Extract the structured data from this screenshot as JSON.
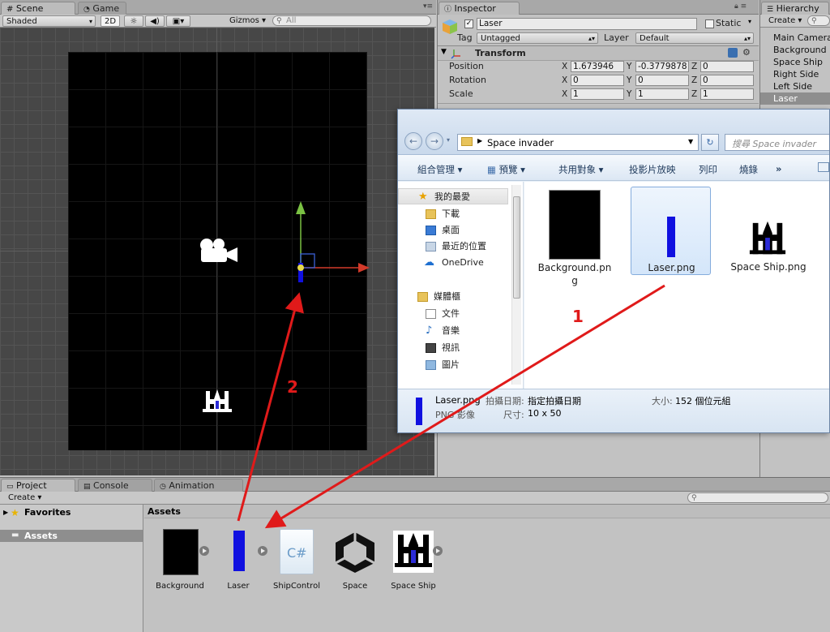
{
  "scene": {
    "tab_label": "Scene",
    "game_tab_label": "Game",
    "shading_mode": "Shaded",
    "mode_2d": "2D",
    "gizmos_label": "Gizmos",
    "search_placeholder": "All"
  },
  "inspector": {
    "tab_label": "Inspector",
    "object_name": "Laser",
    "static_label": "Static",
    "tag_label": "Tag",
    "tag_value": "Untagged",
    "layer_label": "Layer",
    "layer_value": "Default",
    "transform": {
      "title": "Transform",
      "rows": [
        {
          "label": "Position",
          "x": "1.673946",
          "y": "-0.3779878",
          "z": "0"
        },
        {
          "label": "Rotation",
          "x": "0",
          "y": "0",
          "z": "0"
        },
        {
          "label": "Scale",
          "x": "1",
          "y": "1",
          "z": "1"
        }
      ],
      "axis_x": "X",
      "axis_y": "Y",
      "axis_z": "Z"
    }
  },
  "hierarchy": {
    "tab_label": "Hierarchy",
    "create_label": "Create",
    "items": [
      "Main Camera",
      "Background",
      "Space Ship",
      "Right Side",
      "Left Side",
      "Laser"
    ],
    "selected": "Laser"
  },
  "project": {
    "tab_project": "Project",
    "tab_console": "Console",
    "tab_animation": "Animation",
    "create_label": "Create",
    "favorites_label": "Favorites",
    "assets_tree_label": "Assets",
    "assets_header": "Assets",
    "assets": [
      {
        "name": "Background"
      },
      {
        "name": "Laser"
      },
      {
        "name": "ShipControl",
        "icon_text": "C#"
      },
      {
        "name": "Space"
      },
      {
        "name": "Space Ship"
      }
    ]
  },
  "explorer": {
    "breadcrumb": "Space invader",
    "search_placeholder": "搜尋 Space invader",
    "commands": [
      "組合管理",
      "預覽",
      "共用對象",
      "投影片放映",
      "列印",
      "燒錄"
    ],
    "more_label": "»",
    "nav": {
      "favorites_label": "我的最愛",
      "favorites": [
        "下載",
        "桌面",
        "最近的位置",
        "OneDrive"
      ],
      "library_label": "媒體櫃",
      "library": [
        "文件",
        "音樂",
        "視訊",
        "圖片"
      ]
    },
    "files": [
      {
        "name_line1": "Background.pn",
        "name_line2": "g"
      },
      {
        "name_line1": "Laser.png",
        "name_line2": ""
      },
      {
        "name_line1": "Space Ship.png",
        "name_line2": ""
      }
    ],
    "details": {
      "file_name": "Laser.png",
      "file_type": "PNG 影像",
      "date_label": "拍攝日期:",
      "date_value": "指定拍攝日期",
      "dim_label": "尺寸:",
      "dim_value": "10 x 50",
      "size_label": "大小:",
      "size_value": "152 個位元組"
    }
  },
  "annotations": {
    "arrow1_label": "1",
    "arrow2_label": "2"
  },
  "colors": {
    "annotation_red": "#e01a1a",
    "laser_blue": "#1010e0",
    "gizmo_green": "#7ac143",
    "gizmo_red": "#d23a2a",
    "selection_gray": "#8e8e8e"
  }
}
